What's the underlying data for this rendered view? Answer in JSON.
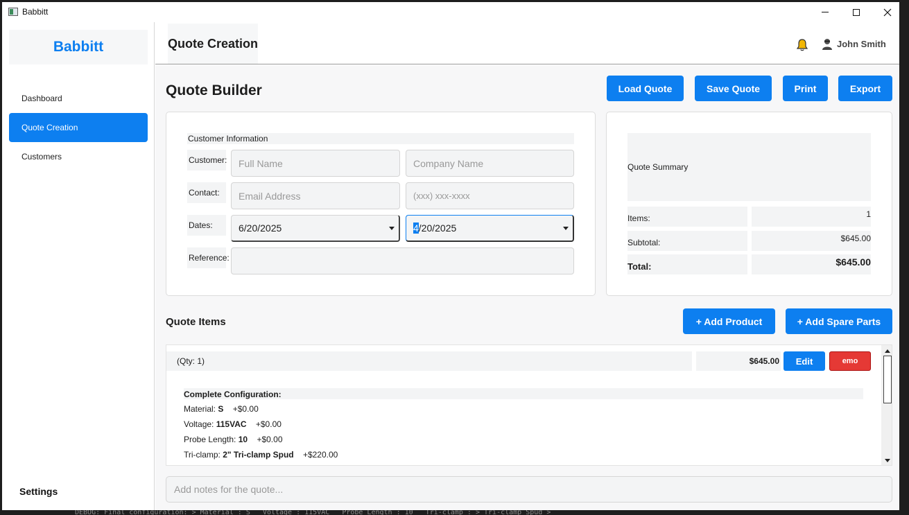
{
  "window": {
    "title": "Babbitt"
  },
  "sidebar": {
    "brand": "Babbitt",
    "items": [
      {
        "label": "Dashboard",
        "active": false
      },
      {
        "label": "Quote Creation",
        "active": true
      },
      {
        "label": "Customers",
        "active": false
      }
    ],
    "settings_label": "Settings"
  },
  "header": {
    "title": "Quote Creation",
    "user_name": "John Smith"
  },
  "toolbar": {
    "page_title": "Quote Builder",
    "load_label": "Load Quote",
    "save_label": "Save Quote",
    "print_label": "Print",
    "export_label": "Export"
  },
  "customer": {
    "section_label": "Customer Information",
    "customer_label": "Customer:",
    "contact_label": "Contact:",
    "dates_label": "Dates:",
    "reference_label": "Reference:",
    "full_name_placeholder": "Full Name",
    "company_placeholder": "Company Name",
    "email_placeholder": "Email Address",
    "phone_placeholder": "(xxx) xxx-xxxx",
    "date_start": "6/20/2025",
    "date_end_first": "4",
    "date_end_rest": "/20/2025",
    "reference_value": ""
  },
  "summary": {
    "title": "Quote Summary",
    "items_label": "Items:",
    "items_value": "1",
    "subtotal_label": "Subtotal:",
    "subtotal_value": "$645.00",
    "total_label": "Total:",
    "total_value": "$645.00"
  },
  "quote_items": {
    "title": "Quote Items",
    "add_product_label": "+ Add Product",
    "add_spare_label": "+ Add Spare Parts",
    "item": {
      "qty_text": "(Qty: 1)",
      "price": "$645.00",
      "edit_label": "Edit",
      "remove_label": "emo",
      "config_title": "Complete Configuration:",
      "config": [
        {
          "name": "Material:",
          "value": "S",
          "price": "+$0.00"
        },
        {
          "name": "Voltage:",
          "value": "115VAC",
          "price": "+$0.00"
        },
        {
          "name": "Probe Length:",
          "value": "10",
          "price": "+$0.00"
        },
        {
          "name": "Tri-clamp:",
          "value": "2\" Tri-clamp Spud",
          "price": "+$220.00"
        }
      ]
    }
  },
  "notes": {
    "placeholder": "Add notes for the quote..."
  },
  "colors": {
    "accent": "#0d7ff0",
    "danger": "#e53935",
    "bell": "#f2b705"
  },
  "backdrop_text": "DEBUG: Final configuration: > Material : S   Voltage : 115VAC   Probe Length : 10   Tri-clamp : > Tri-clamp Spud >"
}
